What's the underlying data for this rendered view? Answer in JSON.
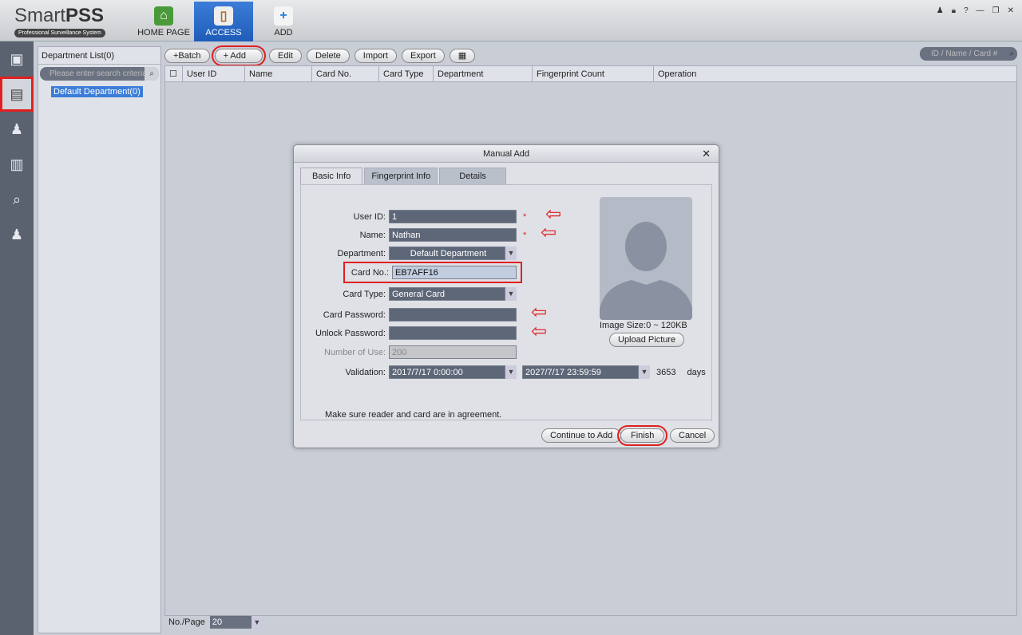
{
  "app": {
    "name_light": "Smart",
    "name_bold": "PSS",
    "tagline": "Professional Surveillance System"
  },
  "nav": [
    {
      "label": "HOME PAGE",
      "icon": "home-icon"
    },
    {
      "label": "ACCESS",
      "icon": "door-icon",
      "active": true
    },
    {
      "label": "ADD",
      "icon": "plus-icon"
    }
  ],
  "window_controls": [
    "user-icon",
    "lock-icon",
    "?",
    "minimize-icon",
    "restore-icon",
    "close-icon"
  ],
  "sidebar": [
    "door-person-icon",
    "user-card-icon",
    "user-settings-icon",
    "door-record-icon",
    "search-record-icon",
    "user-gear-icon"
  ],
  "department": {
    "title": "Department List(0)",
    "search_placeholder": "Please enter search criteria",
    "node": "Default Department(0)"
  },
  "toolbar": {
    "batch": "+Batch",
    "add": "+ Add",
    "edit": "Edit",
    "delete": "Delete",
    "import": "Import",
    "export": "Export",
    "search_placeholder": "ID / Name / Card #"
  },
  "table": {
    "columns": [
      "User ID",
      "Name",
      "Card No.",
      "Card Type",
      "Department",
      "Fingerprint Count",
      "Operation"
    ]
  },
  "footer": {
    "label": "No./Page",
    "value": "20"
  },
  "dialog": {
    "title": "Manual Add",
    "tabs": [
      "Basic Info",
      "Fingerprint Info",
      "Details"
    ],
    "fields": {
      "user_id_label": "User ID:",
      "user_id": "1",
      "name_label": "Name:",
      "name": "Nathan",
      "department_label": "Department:",
      "department": "Default Department",
      "card_no_label": "Card No.:",
      "card_no": "EB7AFF16",
      "card_type_label": "Card Type:",
      "card_type": "General Card",
      "card_password_label": "Card Password:",
      "card_password": "",
      "unlock_password_label": "Unlock Password:",
      "unlock_password": "",
      "number_of_use_label": "Number of Use:",
      "number_of_use": "200",
      "validation_label": "Validation:",
      "valid_from": "2017/7/17 0:00:00",
      "valid_to": "2027/7/17 23:59:59",
      "days_value": "3653",
      "days_label": "days",
      "required_mark": "*"
    },
    "image_size": "Image Size:0 ~ 120KB",
    "upload": "Upload Picture",
    "note": "Make sure reader and card are in agreement.",
    "buttons": {
      "continue": "Continue to Add",
      "finish": "Finish",
      "cancel": "Cancel"
    }
  },
  "colors": {
    "accent": "#1e5cb8",
    "highlight": "#e02020",
    "field": "#5e6778"
  }
}
